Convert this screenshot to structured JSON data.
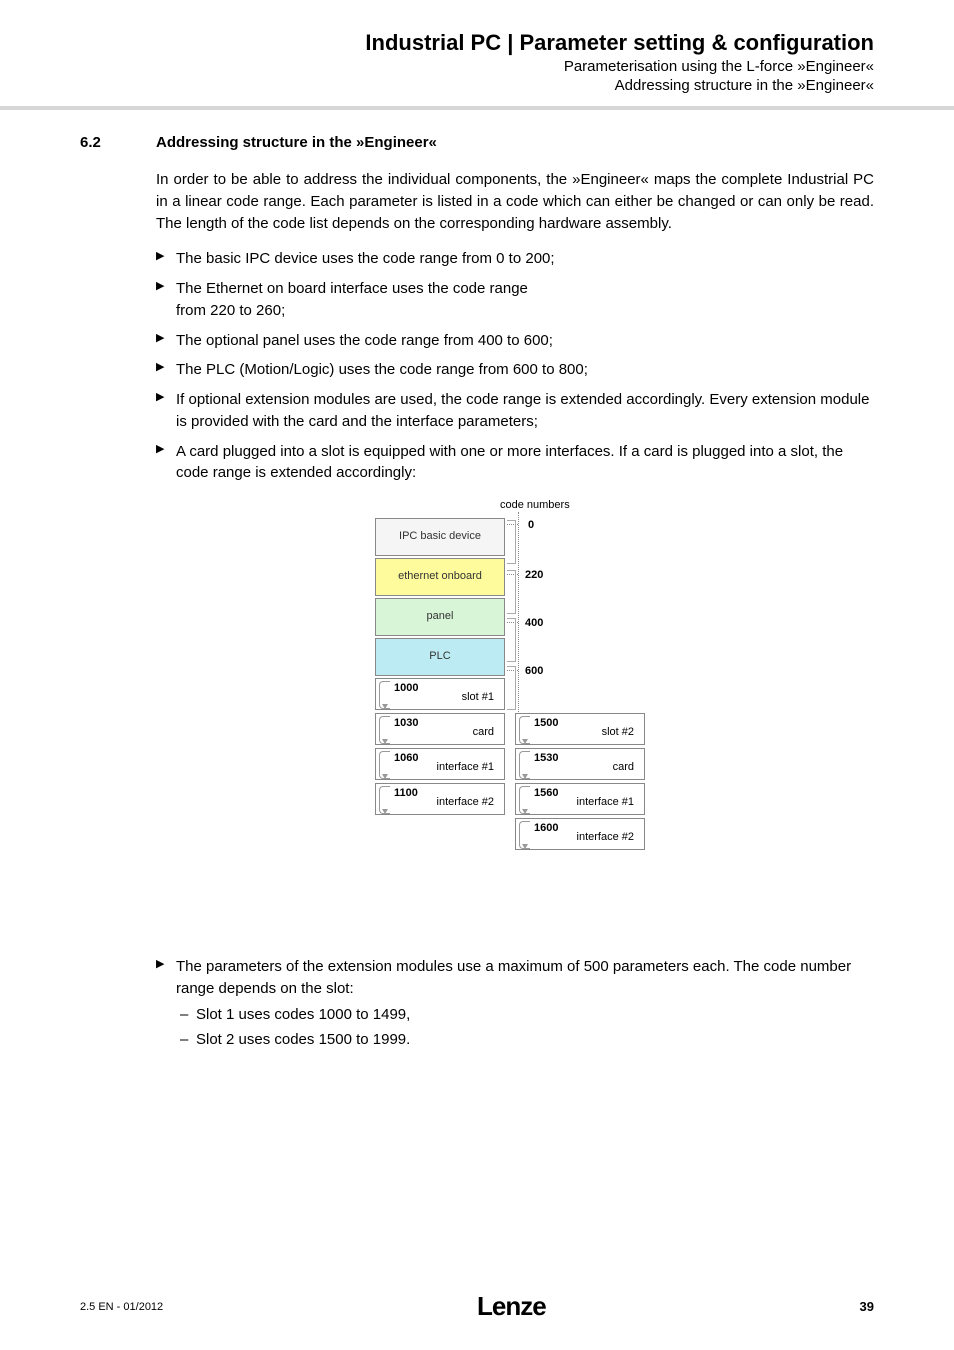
{
  "header": {
    "title": "Industrial PC | Parameter setting & configuration",
    "sub1": "Parameterisation using the L-force »Engineer«",
    "sub2": "Addressing structure in the »Engineer«"
  },
  "section": {
    "number": "6.2",
    "heading": "Addressing structure in the »Engineer«"
  },
  "intro": "In order to be able to address the individual components, the »Engineer« maps the complete Industrial PC in a linear code range. Each parameter is listed in a code which can either be changed or can only be read. The length of the code list depends on the corresponding hardware assembly.",
  "bullets_top": [
    "The basic IPC device uses the code range from 0 to 200;",
    "The Ethernet on board interface uses the code range\nfrom 220 to 260;",
    "The optional panel uses the code range from 400 to 600;",
    "The PLC (Motion/Logic) uses the code range from 600 to 800;",
    "If optional extension modules are used, the code range is extended accordingly. Every extension module is provided with the card and the interface parameters;",
    "A card plugged into a slot is equipped with one or more interfaces. If a card is plugged into a slot, the code range is extended accordingly:"
  ],
  "bullet_bottom": "The parameters of the extension modules use a maximum of 500 parameters each. The code number range depends on the slot:",
  "sub_bullets": [
    "Slot 1 uses codes 1000 to 1499,",
    "Slot 2 uses codes 1500 to 1999."
  ],
  "footer": {
    "left": "2.5 EN - 01/2012",
    "logo": "Lenze",
    "page": "39"
  },
  "chart_data": {
    "type": "diagram",
    "title": "code numbers",
    "base_blocks": [
      {
        "label": "IPC basic device",
        "code_start": 0
      },
      {
        "label": "ethernet onboard",
        "code_start": 220
      },
      {
        "label": "panel",
        "code_start": 400
      },
      {
        "label": "PLC",
        "code_start": 600
      }
    ],
    "slots": [
      {
        "slot_label": "slot #1",
        "slot_code": 1000,
        "card": {
          "label": "card",
          "code": 1030
        },
        "interfaces": [
          {
            "label": "interface #1",
            "code": 1060
          },
          {
            "label": "interface #2",
            "code": 1100
          }
        ]
      },
      {
        "slot_label": "slot #2",
        "slot_code": 1500,
        "card": {
          "label": "card",
          "code": 1530
        },
        "interfaces": [
          {
            "label": "interface #1",
            "code": 1560
          },
          {
            "label": "interface #2",
            "code": 1600
          }
        ]
      }
    ]
  }
}
